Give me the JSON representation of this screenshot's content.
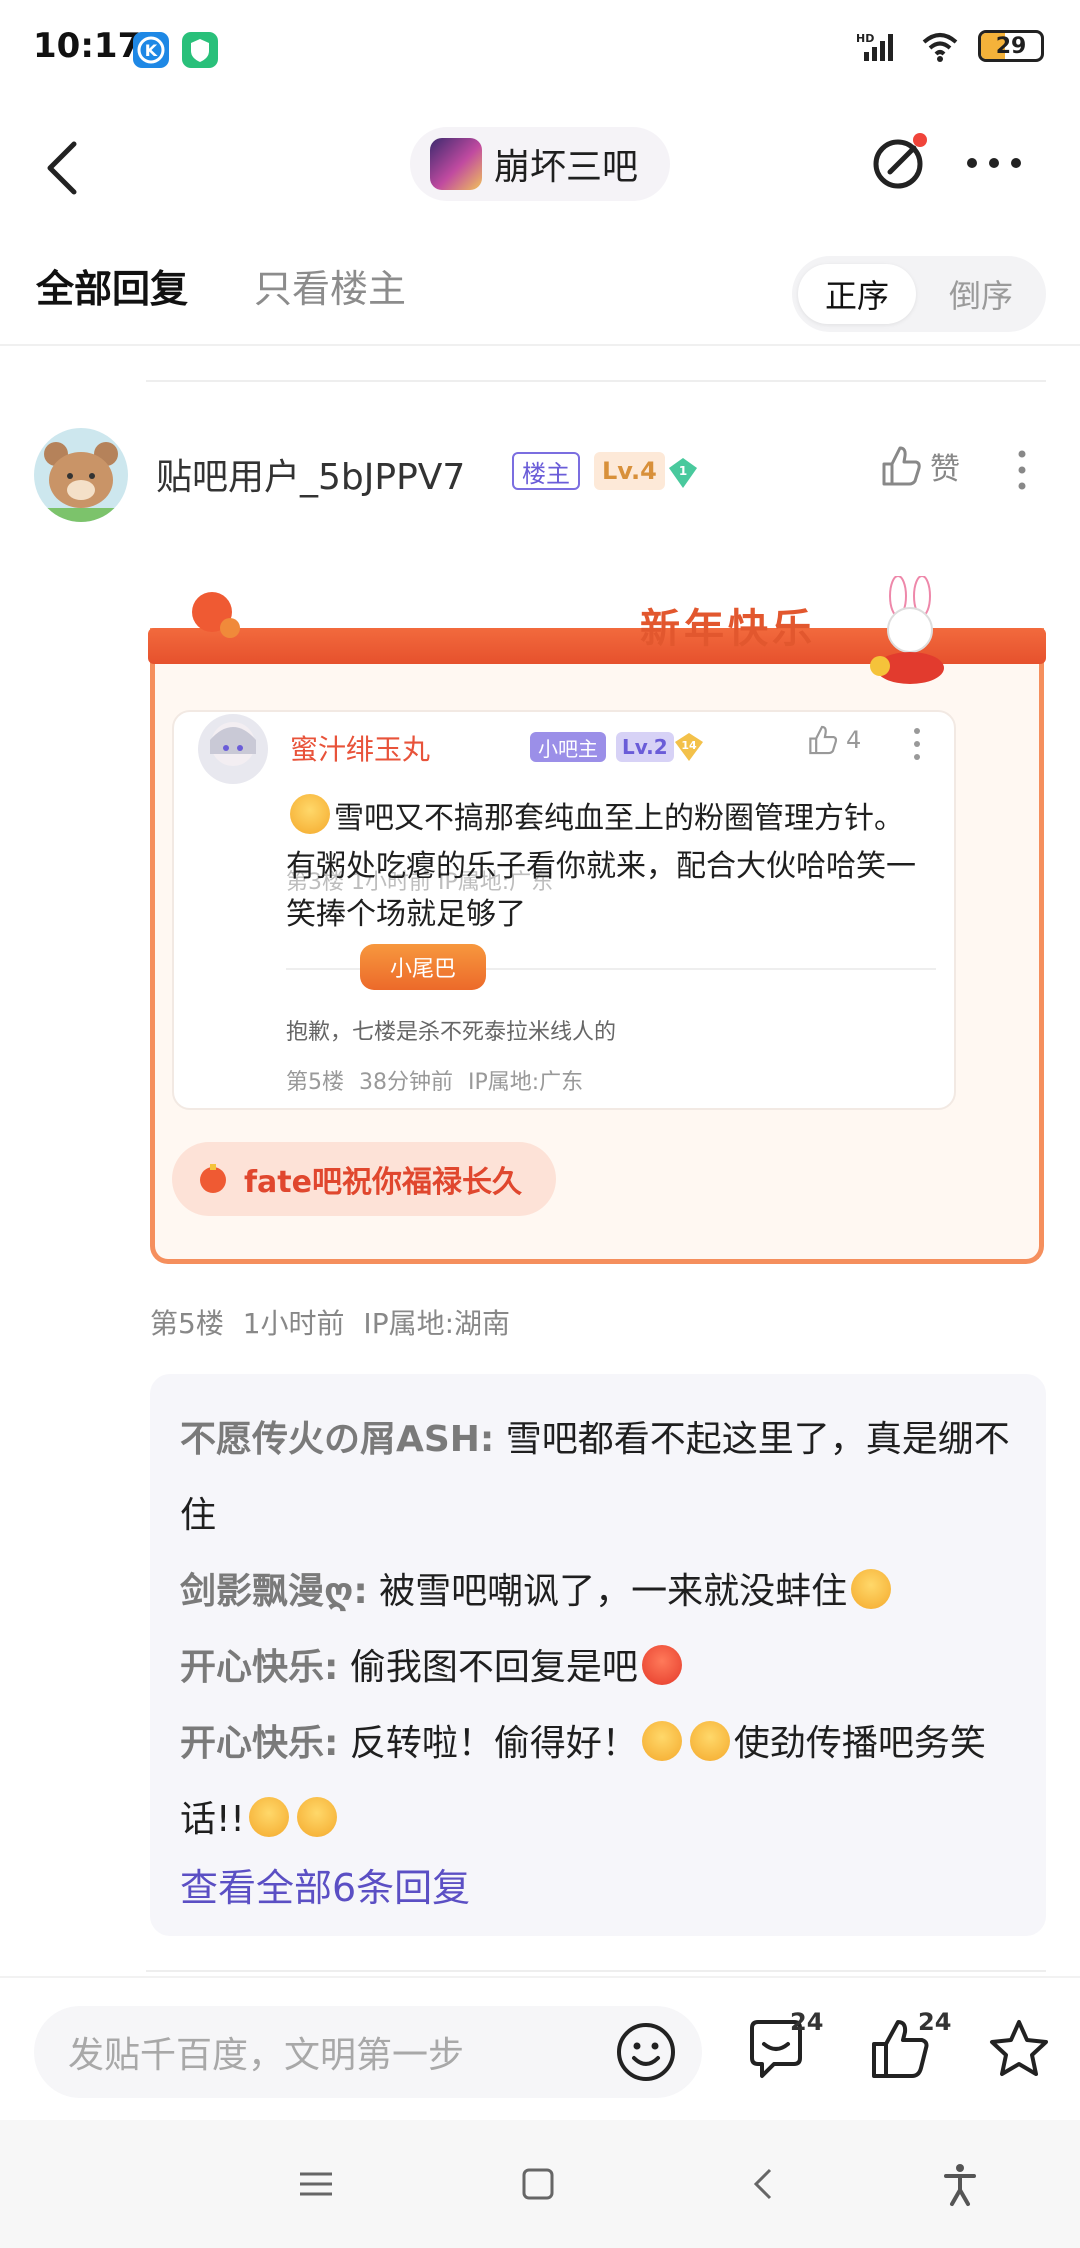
{
  "status_bar": {
    "time": "10:17",
    "battery": "29",
    "app_icon_colors": [
      "#1e88e5",
      "#29c07a"
    ]
  },
  "header": {
    "forum_name": "崩坏三吧"
  },
  "tabs": {
    "all": "全部回复",
    "owner_only": "只看楼主",
    "sort_asc": "正序",
    "sort_desc": "倒序"
  },
  "post": {
    "username": "贴吧用户_5bJPPV7",
    "owner_badge": "楼主",
    "level": "Lv.4",
    "gem_level": "1",
    "like_label": "赞",
    "card_title": "新年快乐",
    "quote": {
      "username": "蜜汁绯玉丸",
      "admin_badge": "小吧主",
      "level": "Lv.2",
      "gem_level": "14",
      "likes": "4",
      "content": "雪吧又不搞那套纯血至上的粉圈管理方针。有粥处吃瘪的乐子看你就来，配合大伙哈哈笑一笑捧个场就足够了",
      "ghost_meta": "第3楼   1小时前   IP属地:广东",
      "tail_label": "小尾巴",
      "signature": "抱歉，七楼是杀不死泰拉米线人的",
      "meta": "第5楼 38分钟前 IP属地:广东"
    },
    "blessing": "fate吧祝你福禄长久",
    "floor_meta": "第5楼 1小时前 IP属地:湖南"
  },
  "sub_replies": {
    "items": [
      {
        "author": "不愿传火の屑ASH:",
        "text": " 雪吧都看不起这里了，真是绷不住"
      },
      {
        "author": "剑影飘漫ღ:",
        "text": " 被雪吧嘲讽了，一来就没蚌住"
      },
      {
        "author": "开心快乐:",
        "text": " 偷我图不回复是吧"
      },
      {
        "author": "开心快乐:",
        "text": " 反转啦！偷得好！"
      },
      {
        "text2": "使劲传播吧务笑话!!"
      }
    ],
    "view_all": "查看全部6条回复"
  },
  "reply_bar": {
    "placeholder": "发贴千百度，文明第一步",
    "comment_count": "24",
    "like_count": "24"
  }
}
